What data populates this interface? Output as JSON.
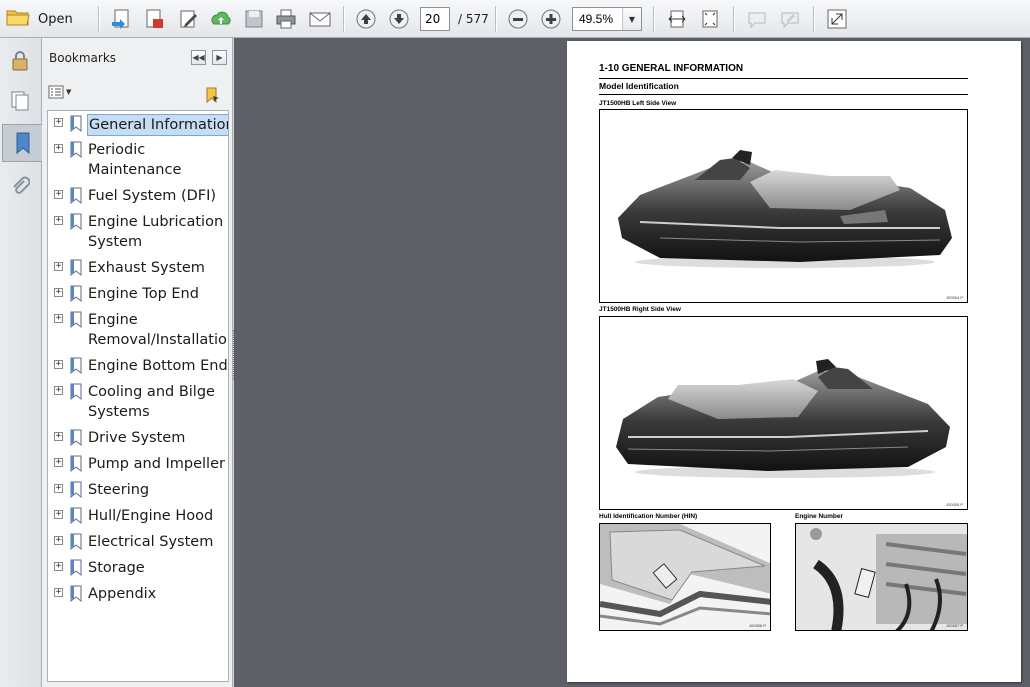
{
  "toolbar": {
    "open_label": "Open",
    "page_current": "20",
    "page_total": "/ 577",
    "zoom": "49.5%"
  },
  "bookmarks": {
    "title": "Bookmarks",
    "items": [
      {
        "label": "General Information",
        "selected": true
      },
      {
        "label": "Periodic Maintenance"
      },
      {
        "label": "Fuel System (DFI)"
      },
      {
        "label": "Engine Lubrication System"
      },
      {
        "label": "Exhaust System"
      },
      {
        "label": "Engine Top End"
      },
      {
        "label": "Engine Removal/Installation"
      },
      {
        "label": "Engine Bottom End"
      },
      {
        "label": "Cooling and Bilge Systems"
      },
      {
        "label": "Drive System"
      },
      {
        "label": "Pump and Impeller"
      },
      {
        "label": "Steering"
      },
      {
        "label": "Hull/Engine Hood"
      },
      {
        "label": "Electrical System"
      },
      {
        "label": "Storage"
      },
      {
        "label": "Appendix"
      }
    ]
  },
  "document": {
    "heading": "1-10 GENERAL INFORMATION",
    "subheading": "Model Identification",
    "fig1_caption": "JT1500HB Left Side View",
    "fig2_caption": "JT1500HB Right Side View",
    "fig3_caption": "Hull Identification Number (HIN)",
    "fig4_caption": "Engine Number",
    "fig1_code": "J00304  P",
    "fig2_code": "J00305  P",
    "fig3_code": "J00306  P",
    "fig4_code": "J00307  P"
  },
  "colors": {
    "viewer_bg": "#5d6167",
    "selection": "#c7ddf3",
    "toolbar_bg": "#eceef1"
  }
}
